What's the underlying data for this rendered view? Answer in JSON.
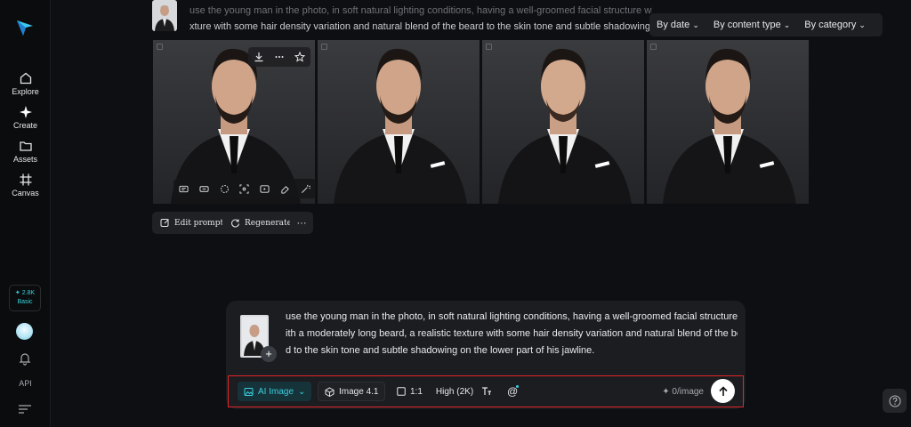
{
  "sidebar": {
    "items": [
      {
        "label": "Explore",
        "icon": "home-icon"
      },
      {
        "label": "Create",
        "icon": "sparkle-icon"
      },
      {
        "label": "Assets",
        "icon": "folder-icon"
      },
      {
        "label": "Canvas",
        "icon": "frame-icon"
      }
    ],
    "credits": {
      "amount": "2.8K",
      "plan": "Basic",
      "icon": "sparkle-icon"
    },
    "api_label": "API"
  },
  "top_prompt": {
    "line1": "use the young man in the photo, in soft natural lighting conditions, having a well-groomed facial structure with a moderately long beard, a realistic te",
    "line2": "xture with some hair density variation and natural blend of the beard to the skin tone and subtle shadowing on"
  },
  "filters": [
    {
      "label": "By date"
    },
    {
      "label": "By content type"
    },
    {
      "label": "By category"
    }
  ],
  "result_actions": {
    "edit_prompt": "Edit prompt",
    "regenerate": "Regenerate",
    "more": "···"
  },
  "composer": {
    "prompt_lines": [
      "use the young man in the photo, in soft natural lighting conditions, having a well-groomed facial structure w",
      "ith a moderately long beard, a realistic texture with some hair density variation and natural blend of the bear",
      "d to the skin tone and subtle shadowing on the lower part of his jawline."
    ],
    "mode": "AI Image",
    "model": "Image 4.1",
    "ratio": "1:1",
    "quality": "High (2K)",
    "cost": "0/image",
    "accent": "#3ad0e0",
    "highlight": "#e0262a"
  }
}
